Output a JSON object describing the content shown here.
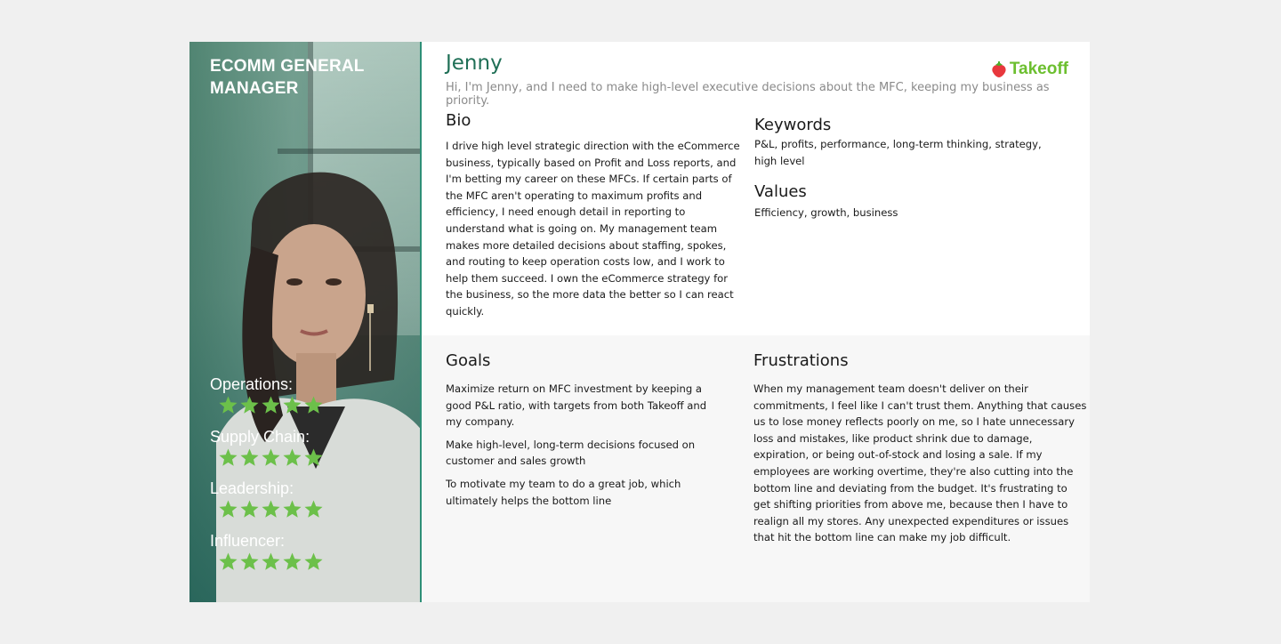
{
  "persona": {
    "role": "ECOMM GENERAL MANAGER",
    "name": "Jenny",
    "intro": "Hi, I'm Jenny, and I need to make high-level executive decisions about the MFC, keeping my business as priority."
  },
  "logo": {
    "text": "Takeoff",
    "icon": "strawberry-icon",
    "color": "#6cbf2f"
  },
  "skills": [
    {
      "label": "Operations:",
      "rating": 5,
      "max": 5
    },
    {
      "label": "Supply Chain:",
      "rating": 5,
      "max": 5
    },
    {
      "label": "Leadership:",
      "rating": 5,
      "max": 5
    },
    {
      "label": "Influencer:",
      "rating": 5,
      "max": 5
    }
  ],
  "bio": {
    "heading": "Bio",
    "text": "I drive high level strategic direction with the eCommerce business, typically based on Profit and Loss reports, and I'm betting my career on these MFCs. If certain parts of the MFC aren't operating to maximum profits and efficiency, I need enough detail in reporting to understand what is going on. My management team makes more detailed decisions about staffing, spokes, and routing to keep operation costs low, and I work to help them succeed. I own the eCommerce strategy for the business, so the more data the better so I can react quickly."
  },
  "keywords": {
    "heading": "Keywords",
    "text": "P&L, profits, performance, long-term thinking, strategy, high level"
  },
  "values": {
    "heading": "Values",
    "text": "Efficiency, growth, business"
  },
  "goals": {
    "heading": "Goals",
    "items": [
      "Maximize return on MFC investment by keeping a good P&L ratio, with targets from both Takeoff and my company.",
      "Make high-level, long-term decisions focused on customer and sales growth",
      "To motivate my team to do a great job, which ultimately helps the bottom line"
    ]
  },
  "frustrations": {
    "heading": "Frustrations",
    "text": "When my management team doesn't deliver on their commitments, I feel like I can't trust them. Anything that causes us to lose money reflects poorly on me, so I hate unnecessary loss and mistakes, like product shrink due to damage, expiration, or being out-of-stock and losing a sale. If my employees are working overtime, they're also cutting into the bottom line and deviating from the budget. It's frustrating to get shifting priorities from above me, because then I have to realign all my stores. Any unexpected expenditures or issues that hit the bottom line can make my job difficult."
  },
  "colors": {
    "accent_green": "#1f6f56",
    "star_green": "#6cc04a",
    "panel_overlay": "#2e7d68"
  }
}
